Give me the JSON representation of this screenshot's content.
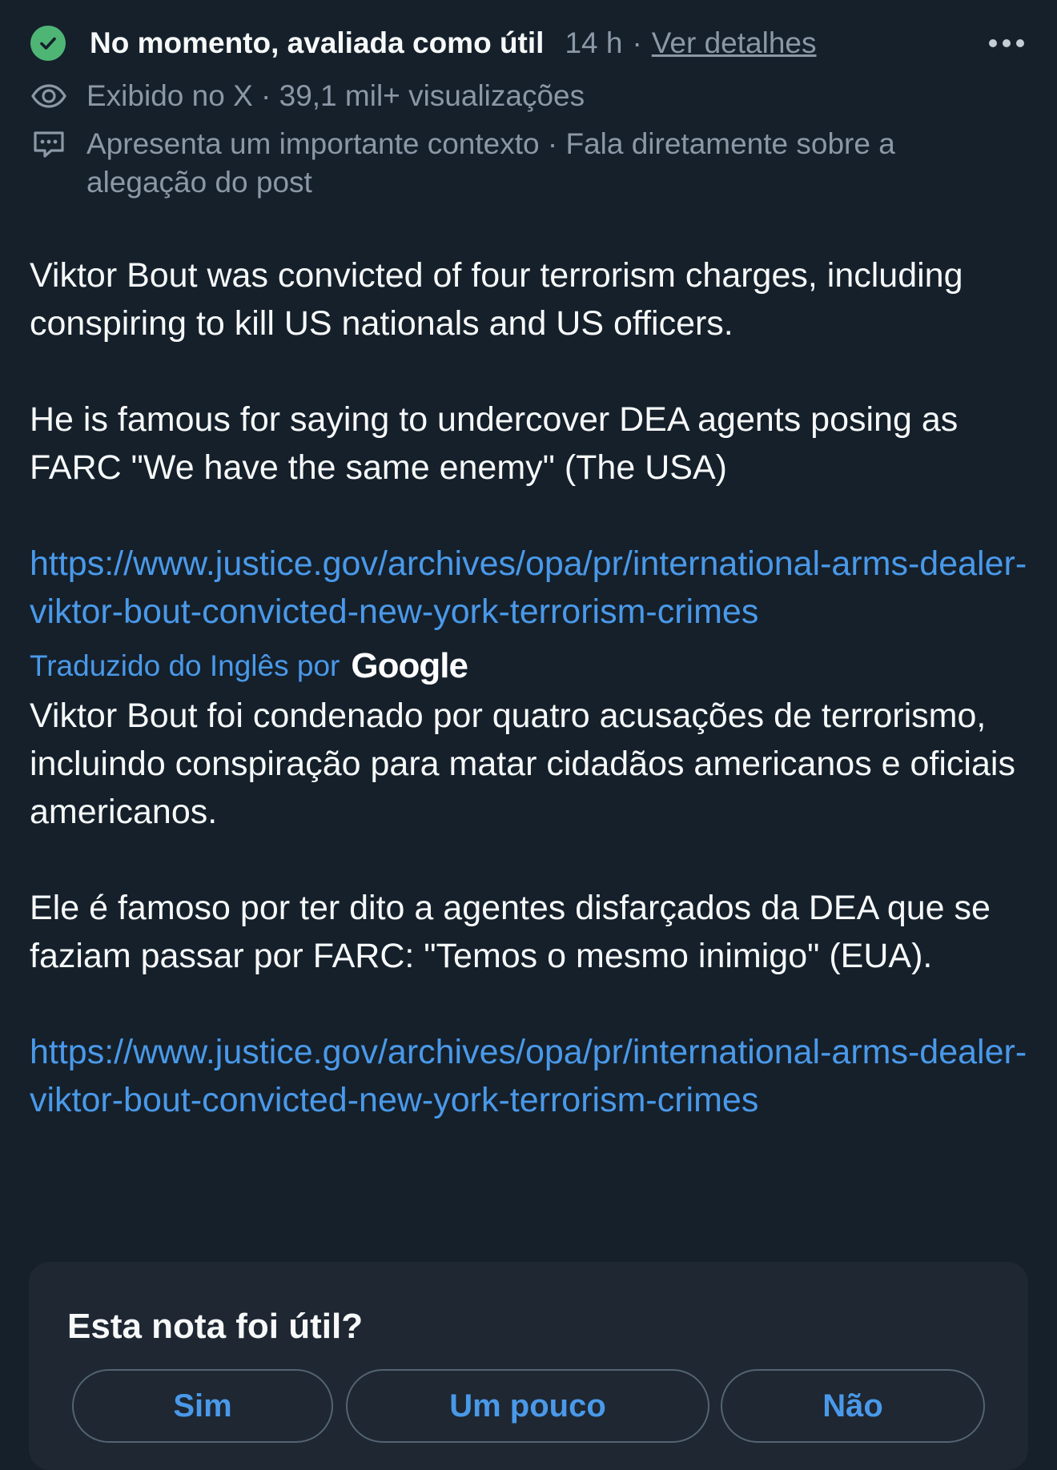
{
  "colors": {
    "background": "#15202b",
    "text_primary": "#f7f9f9",
    "text_secondary": "#8b98a5",
    "link": "#4a99e9",
    "status_green": "#4fb575",
    "card_background": "#1e2732"
  },
  "header": {
    "status_icon": "check-circle-icon",
    "status_title": "No momento, avaliada como útil",
    "time": "14 h",
    "separator": "·",
    "details_link": "Ver detalhes",
    "more_icon": "more-horizontal-icon"
  },
  "meta": {
    "views_icon": "eye-icon",
    "views_text": "Exibido no X · 39,1 mil+ visualizações",
    "context_icon": "comment-icon",
    "context_text": "Apresenta um importante contexto · Fala diretamente sobre a alegação do post"
  },
  "note": {
    "original_para1": "Viktor Bout was convicted of four terrorism charges, including conspiring to kill US nationals and US officers.",
    "original_para2": "He is famous for saying to undercover DEA agents posing as FARC \"We have the same enemy\" (The USA)",
    "original_link": "https://www.justice.gov/archives/opa/pr/international-arms-dealer-viktor-bout-convicted-new-york-terrorism-crimes",
    "translated_by": "Traduzido do Inglês por",
    "translator_brand": "Google",
    "translated_para1": "Viktor Bout foi condenado por quatro acusações de terrorismo, incluindo conspiração para matar cidadãos americanos e oficiais americanos.",
    "translated_para2": "Ele é famoso por ter dito a agentes disfarçados da DEA que se faziam passar por FARC: \"Temos o mesmo inimigo\" (EUA).",
    "translated_link": "https://www.justice.gov/archives/opa/pr/international-arms-dealer-viktor-bout-convicted-new-york-terrorism-crimes"
  },
  "feedback": {
    "question": "Esta nota foi útil?",
    "buttons": [
      "Sim",
      "Um pouco",
      "Não"
    ]
  }
}
